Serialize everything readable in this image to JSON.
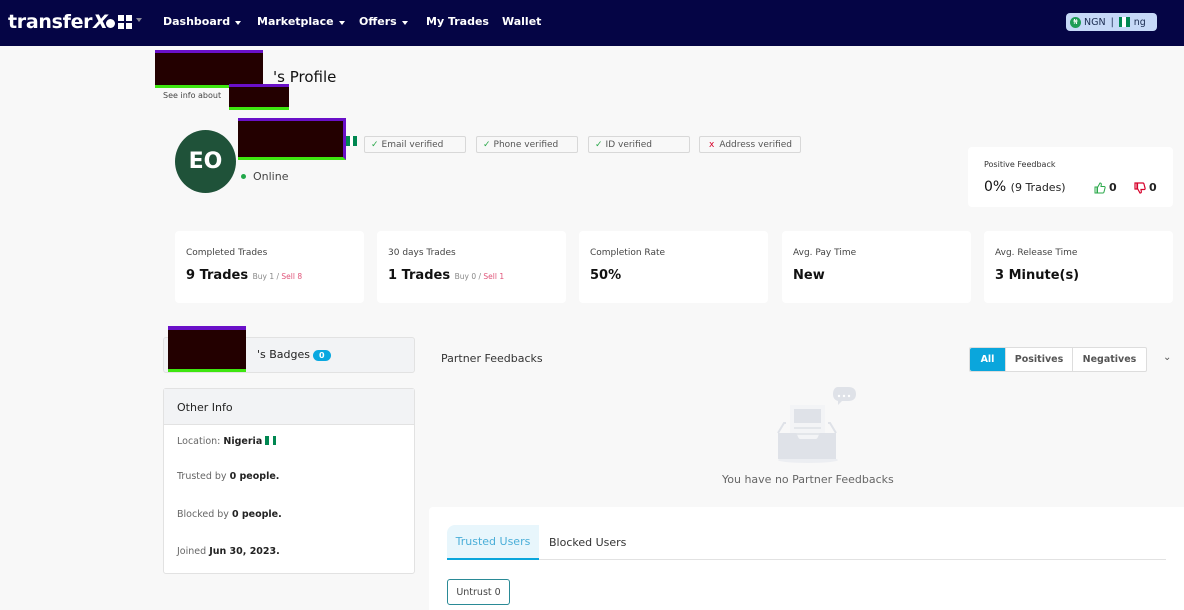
{
  "nav": {
    "logo": "transfer",
    "logo_x": "X",
    "items": [
      {
        "label": "Dashboard",
        "dropdown": true
      },
      {
        "label": "Marketplace",
        "dropdown": true
      },
      {
        "label": "Offers",
        "dropdown": true
      },
      {
        "label": "My Trades",
        "dropdown": false
      },
      {
        "label": "Wallet",
        "dropdown": false
      }
    ],
    "currency": "NGN",
    "separator": "|",
    "locale": "ng",
    "currency_icon": "naira-coin-icon"
  },
  "profile": {
    "title_suffix": "'s Profile",
    "subtitle": "See info about",
    "avatar_initials": "EO",
    "status": "Online",
    "verifications": [
      {
        "label": "Email verified",
        "verified": true,
        "icon": "✓"
      },
      {
        "label": "Phone verified",
        "verified": true,
        "icon": "✓"
      },
      {
        "label": "ID verified",
        "verified": true,
        "icon": "✓"
      },
      {
        "label": "Address verified",
        "verified": false,
        "icon": "x"
      }
    ]
  },
  "feedback": {
    "label": "Positive Feedback",
    "percent": "0%",
    "trades": "(9 Trades)",
    "thumbs_up": "0",
    "thumbs_down": "0",
    "up_color": "#2aa84a",
    "down_color": "#d6002a"
  },
  "stats": [
    {
      "label": "Completed Trades",
      "value": "9 Trades",
      "buy": "Buy 1",
      "sell": "Sell 8"
    },
    {
      "label": "30 days Trades",
      "value": "1 Trades",
      "buy": "Buy 0",
      "sell": "Sell 1"
    },
    {
      "label": "Completion Rate",
      "value": "50%"
    },
    {
      "label": "Avg. Pay Time",
      "value": "New"
    },
    {
      "label": "Avg. Release Time",
      "value": "3 Minute(s)"
    }
  ],
  "badges": {
    "label_suffix": "'s Badges",
    "count": "0"
  },
  "other_info": {
    "title": "Other Info",
    "location_label": "Location:",
    "location_value": "Nigeria",
    "trusted_label": "Trusted by",
    "trusted_value": "0 people.",
    "blocked_label": "Blocked by",
    "blocked_value": "0 people.",
    "joined_label": "Joined",
    "joined_value": "Jun 30, 2023."
  },
  "partner_feedbacks": {
    "title": "Partner Feedbacks",
    "filters": [
      "All",
      "Positives",
      "Negatives"
    ],
    "active_filter": "All",
    "empty_text": "You have no Partner Feedbacks"
  },
  "users_tabs": {
    "tabs": [
      "Trusted Users",
      "Blocked Users"
    ],
    "active": "Trusted Users",
    "untrust_label": "Untrust 0"
  },
  "accent_color": "#0aa6dc",
  "nav_color": "#050545"
}
